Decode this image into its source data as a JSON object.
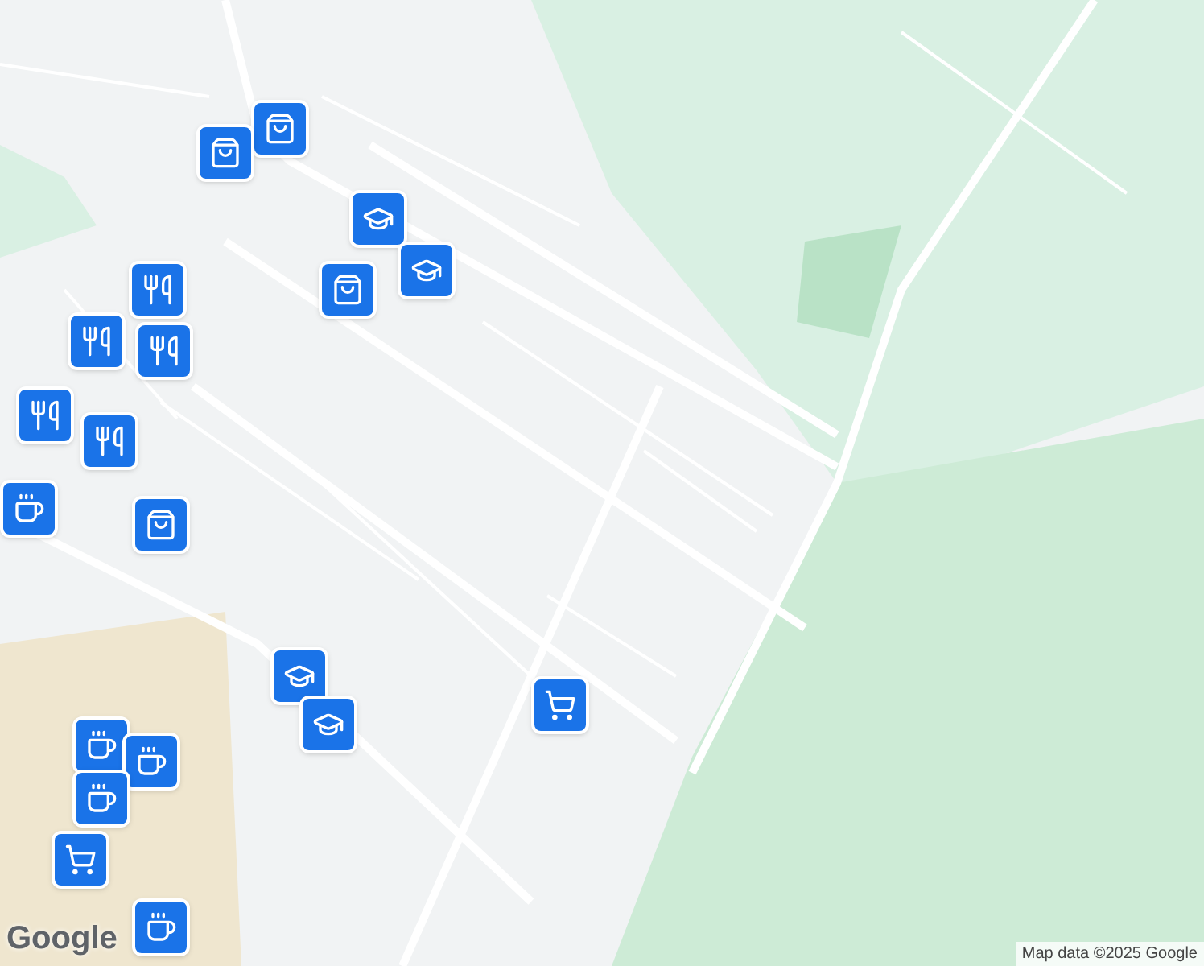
{
  "map": {
    "logo": "Google",
    "attribution": "Map data ©2025 Google"
  }
}
